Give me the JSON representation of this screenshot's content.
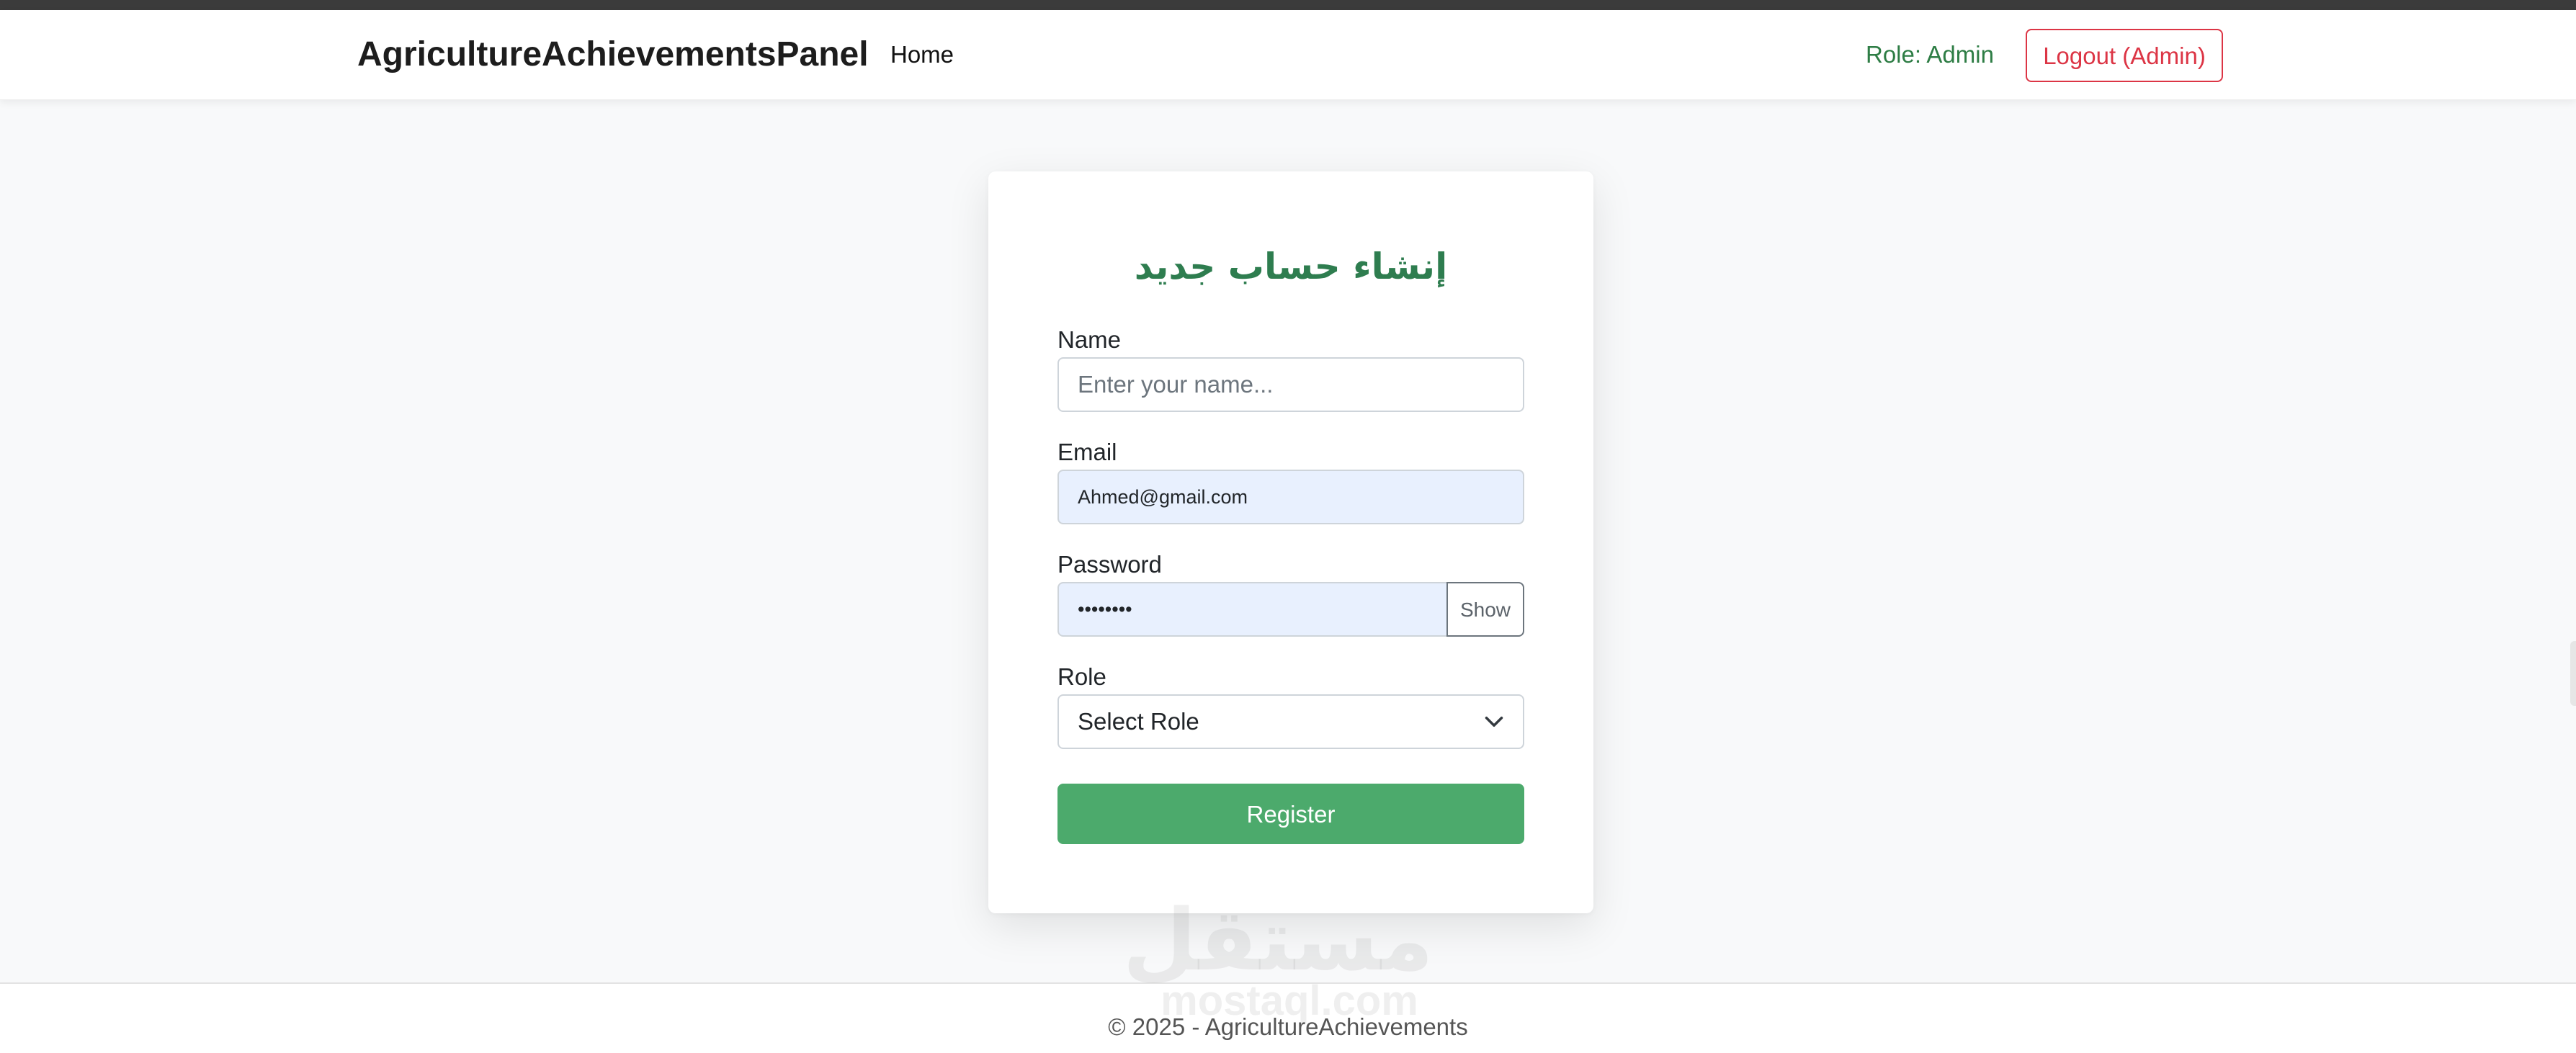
{
  "navbar": {
    "brand": "AgricultureAchievementsPanel",
    "home_link": "Home",
    "role_text": "Role: Admin",
    "logout_label": "Logout (Admin)"
  },
  "form": {
    "title": "إنشاء حساب جديد",
    "name": {
      "label": "Name",
      "placeholder": "Enter your name...",
      "value": ""
    },
    "email": {
      "label": "Email",
      "value": "Ahmed@gmail.com"
    },
    "password": {
      "label": "Password",
      "value": "••••••••",
      "show_label": "Show"
    },
    "role": {
      "label": "Role",
      "selected": "Select Role"
    },
    "register_label": "Register"
  },
  "footer": {
    "text": "© 2025 - AgricultureAchievements"
  },
  "watermark": {
    "arabic": "مستقل",
    "latin": "mostaql.com"
  },
  "colors": {
    "brand_green": "#2e7d4f",
    "register_green": "#4caa6c",
    "logout_red": "#dc3545",
    "autofill_blue": "#e8f0fe"
  },
  "icons": {
    "role_dropdown": "chevron-down-icon"
  }
}
